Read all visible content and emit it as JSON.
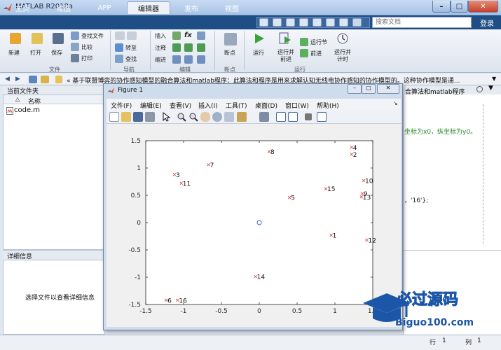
{
  "window": {
    "title": "MATLAB R2018a",
    "minimize": "–",
    "maximize": "□",
    "close": "✕"
  },
  "tabs": [
    "主页",
    "绘图",
    "APP",
    "编辑器",
    "发布",
    "视图"
  ],
  "search": {
    "placeholder": "搜索文档"
  },
  "login": "登录",
  "ribbon": {
    "file": {
      "new": "新建",
      "open": "打开",
      "save": "保存",
      "find_files": "查找文件",
      "compare": "比较",
      "print": "打印",
      "section": "文件"
    },
    "navigate": {
      "goto": "转至",
      "find": "查找",
      "section": "导航"
    },
    "edit": {
      "insert": "插入",
      "comment": "注释",
      "indent": "缩进",
      "fx": "fx",
      "section": "编辑"
    },
    "breakpoints": {
      "label": "断点",
      "section": "断点"
    },
    "run": {
      "run": "运行",
      "run_advance": "运行并前进",
      "run_section": "运行节",
      "advance": "前进",
      "run_time": "运行并计时",
      "section": "运行"
    }
  },
  "addressbar": {
    "text": "«  基于联盟博弈的协作感知模型的融合算法和matlab程序：此算法和程序是用来求解认知无线电协作感知的协作模型的。这种协作模型是通..."
  },
  "current_folder": {
    "title": "当前文件夹",
    "column": "名称",
    "sort_indicator": "△",
    "file": "code.m"
  },
  "details": {
    "title": "详细信息",
    "message": "选择文件以查看详细信息"
  },
  "editor_fragments": {
    "line1": "坐标为x0，纵坐标为y0。",
    "line2": "合算法和matlab程序",
    "line3": "，'16'};"
  },
  "statusbar": {
    "row_label": "行",
    "row_value": "1",
    "col_label": "列",
    "col_value": "1"
  },
  "figure": {
    "title": "Figure 1",
    "menus": [
      "文件(F)",
      "编辑(E)",
      "查看(V)",
      "插入(I)",
      "工具(T)",
      "桌面(D)",
      "窗口(W)",
      "帮助(H)"
    ]
  },
  "watermark": {
    "cn": "必过源码",
    "url": "Biguo100.com"
  },
  "chart_data": {
    "type": "scatter",
    "title": "",
    "xlabel": "",
    "ylabel": "",
    "xlim": [
      -1.5,
      1.5
    ],
    "ylim": [
      -1.5,
      1.5
    ],
    "xticks": [
      "-1.5",
      "-1",
      "-0.5",
      "0",
      "0.5",
      "1",
      "1.5"
    ],
    "yticks": [
      "-1.5",
      "-1",
      "-0.5",
      "0",
      "0.5",
      "1",
      "1.5"
    ],
    "grid": false,
    "series": [
      {
        "marker": "x",
        "color": "#e05050",
        "points": [
          {
            "label": "1",
            "x": 0.95,
            "y": -0.23
          },
          {
            "label": "2",
            "x": 1.22,
            "y": 1.25
          },
          {
            "label": "3",
            "x": -1.12,
            "y": 0.88
          },
          {
            "label": "4",
            "x": 1.22,
            "y": 1.38
          },
          {
            "label": "5",
            "x": 0.4,
            "y": 0.46
          },
          {
            "label": "6",
            "x": -1.23,
            "y": -1.42
          },
          {
            "label": "7",
            "x": -0.67,
            "y": 1.06
          },
          {
            "label": "8",
            "x": 0.13,
            "y": 1.3
          },
          {
            "label": "9",
            "x": 1.36,
            "y": 0.53
          },
          {
            "label": "10",
            "x": 1.38,
            "y": 0.77
          },
          {
            "label": "11",
            "x": -1.03,
            "y": 0.72
          },
          {
            "label": "12",
            "x": 1.42,
            "y": -0.32
          },
          {
            "label": "13",
            "x": 1.35,
            "y": 0.47
          },
          {
            "label": "14",
            "x": -0.05,
            "y": -0.99
          },
          {
            "label": "15",
            "x": 0.88,
            "y": 0.62
          },
          {
            "label": "16",
            "x": -1.08,
            "y": -1.42
          }
        ]
      },
      {
        "marker": "o",
        "color": "#3060c0",
        "points": [
          {
            "label": "",
            "x": 0,
            "y": 0
          }
        ]
      }
    ]
  }
}
